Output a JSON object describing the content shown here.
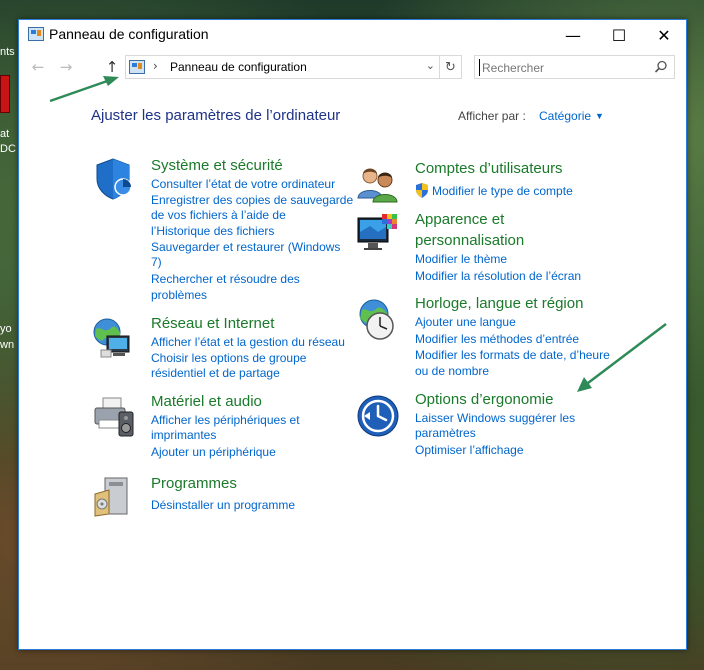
{
  "window": {
    "title": "Panneau de configuration",
    "controls": {
      "minimize": "—",
      "maximize": "☐",
      "close": "✕"
    }
  },
  "nav": {
    "back": "←",
    "forward": "→",
    "up": "↑",
    "breadcrumb_sep": "›",
    "address": "Panneau de configuration",
    "dropdown": "⌄",
    "refresh": "↻"
  },
  "search": {
    "placeholder": "Rechercher",
    "value": ""
  },
  "main": {
    "heading": "Ajuster les paramètres de l’ordinateur",
    "view_by_label": "Afficher par :",
    "view_by_value": "Catégorie",
    "view_by_caret": "▼"
  },
  "categories": {
    "security": {
      "title": "Système et sécurité",
      "links": [
        "Consulter l’état de votre ordinateur",
        "Enregistrer des copies de sauvegarde",
        "de vos fichiers à l’aide de",
        "l’Historique des fichiers",
        "Sauvegarder et restaurer (Windows",
        "7)",
        "Rechercher et résoudre des",
        "problèmes"
      ]
    },
    "network": {
      "title": "Réseau et Internet",
      "links": [
        "Afficher l’état et la gestion du réseau",
        "Choisir les options de groupe",
        "résidentiel et de partage"
      ]
    },
    "hardware": {
      "title": "Matériel et audio",
      "links": [
        "Afficher les périphériques et",
        "imprimantes",
        "Ajouter un périphérique"
      ]
    },
    "programs": {
      "title": "Programmes",
      "links": [
        "Désinstaller un programme"
      ]
    },
    "accounts": {
      "title": "Comptes d’utilisateurs",
      "links": [
        "Modifier le type de compte"
      ]
    },
    "appearance": {
      "title_line1": "Apparence et",
      "title_line2": "personnalisation",
      "links": [
        "Modifier le thème",
        "Modifier la résolution de l’écran"
      ]
    },
    "clock": {
      "title": "Horloge, langue et région",
      "links": [
        "Ajouter une langue",
        "Modifier les méthodes d’entrée",
        "Modifier les formats de date, d’heure",
        "ou de nombre"
      ]
    },
    "ease": {
      "title": "Options d’ergonomie",
      "links": [
        "Laisser Windows suggérer les",
        "paramètres",
        "Optimiser l’affichage"
      ]
    }
  },
  "desktop": {
    "left_text_1": "nts",
    "left_text_2": "at",
    "left_text_3": "DC",
    "left_text_4": "yo",
    "left_text_5": "wn"
  },
  "colors": {
    "title_green": "#1a7a2a",
    "link_blue": "#0066cc",
    "heading_navy": "#1e3287",
    "annotation_arrow": "#2e8b57"
  }
}
